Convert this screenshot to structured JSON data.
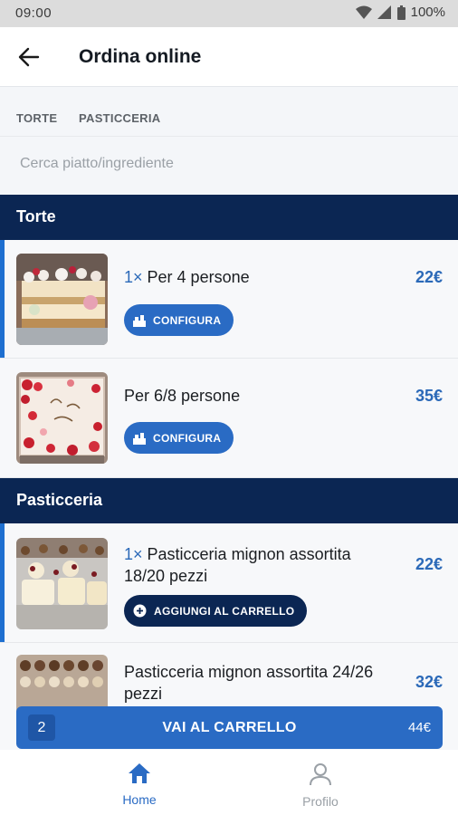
{
  "status_bar": {
    "time": "09:00",
    "battery": "100%"
  },
  "header": {
    "title": "Ordina online",
    "back_icon": "arrow-left-icon"
  },
  "tabs": [
    {
      "label": "TORTE"
    },
    {
      "label": "PASTICCERIA"
    }
  ],
  "search": {
    "placeholder": "Cerca piatto/ingrediente",
    "value": ""
  },
  "sections": [
    {
      "title": "Torte",
      "items": [
        {
          "qty": "1×",
          "name": "Per 4 persone",
          "price": "22€",
          "action": "CONFIGURA",
          "action_icon": "configure-icon",
          "selected": true,
          "image": "layered-cake"
        },
        {
          "qty": "",
          "name": "Per 6/8 persone",
          "price": "35€",
          "action": "CONFIGURA",
          "action_icon": "configure-icon",
          "selected": false,
          "image": "decorated-sheet-cake"
        }
      ]
    },
    {
      "title": "Pasticceria",
      "items": [
        {
          "qty": "1×",
          "name": "Pasticceria mignon assortita 18/20 pezzi",
          "price": "22€",
          "action": "AGGIUNGI AL CARRELLO",
          "action_icon": "plus-circle-icon",
          "selected": true,
          "image": "mignon-pastries"
        },
        {
          "qty": "",
          "name": "Pasticceria mignon assortita 24/26 pezzi",
          "price": "32€",
          "selected": false,
          "image": "mignon-pastries-tray"
        }
      ]
    }
  ],
  "cart": {
    "count": "2",
    "label": "VAI AL CARRELLO",
    "total": "44€"
  },
  "bottom_nav": [
    {
      "label": "Home",
      "icon": "home-icon",
      "active": true
    },
    {
      "label": "Profilo",
      "icon": "profile-icon",
      "active": false
    }
  ],
  "colors": {
    "navy": "#0b2653",
    "accent": "#2a6bc4",
    "price": "#2b69b8",
    "nav_active": "#2a6bc4",
    "nav_inactive": "#9aa0a6"
  }
}
